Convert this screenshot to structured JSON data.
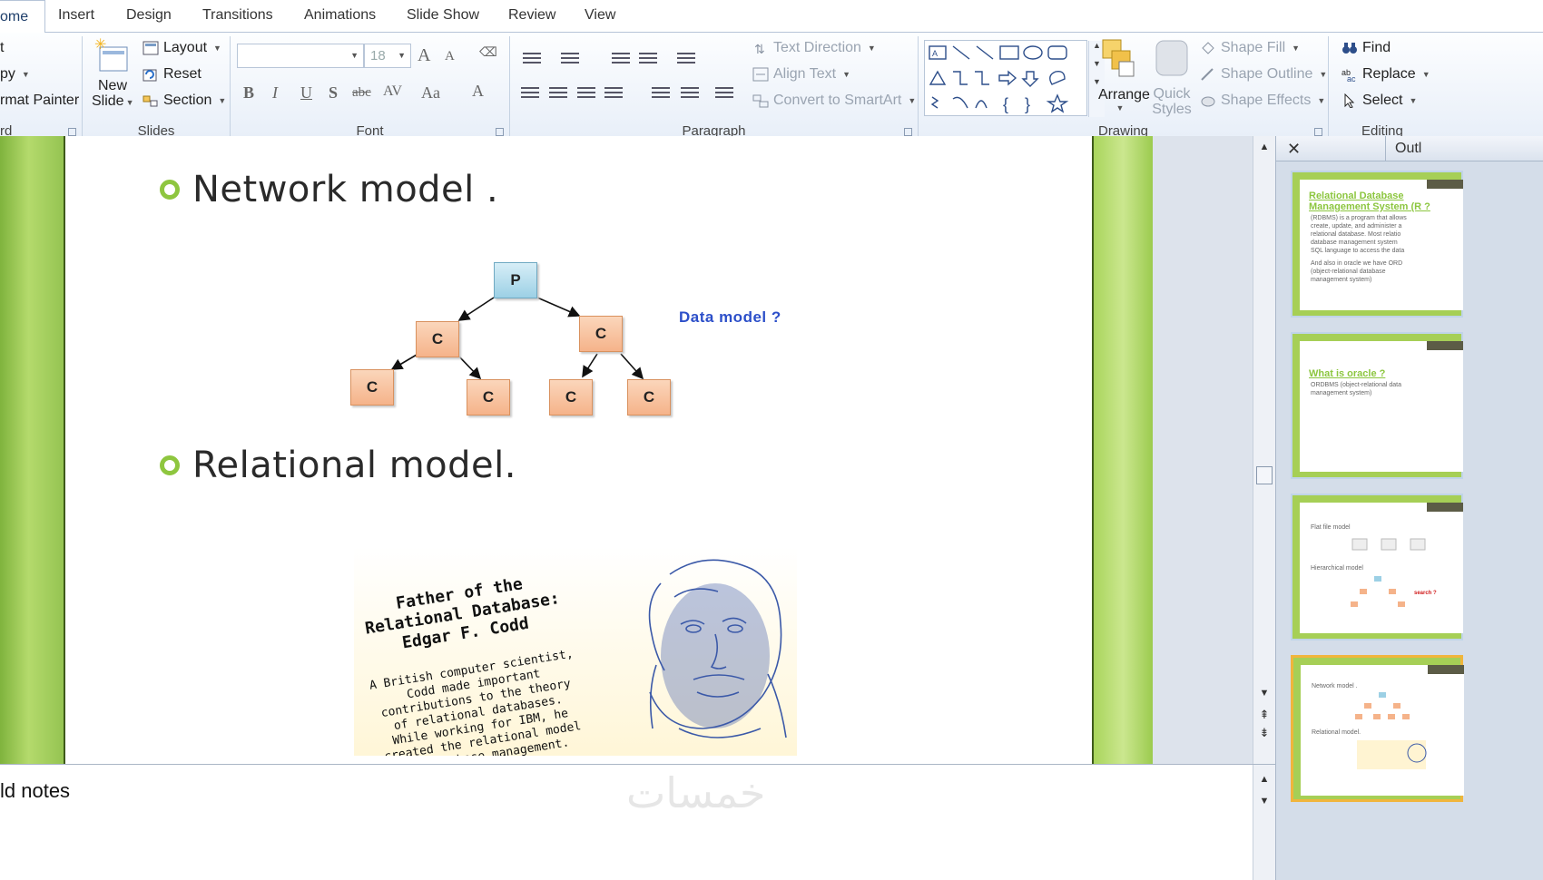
{
  "tabs": [
    "ome",
    "Insert",
    "Design",
    "Transitions",
    "Animations",
    "Slide Show",
    "Review",
    "View"
  ],
  "clipboard": {
    "cut": "t",
    "copy": "py",
    "format_painter": "rmat Painter",
    "label": "rd"
  },
  "slides_group": {
    "new_slide_line1": "New",
    "new_slide_line2": "Slide",
    "layout": "Layout",
    "reset": "Reset",
    "section": "Section",
    "label": "Slides"
  },
  "font_group": {
    "font_name": "",
    "font_size": "18",
    "label": "Font",
    "bold": "B",
    "italic": "I",
    "underline": "U",
    "shadow": "S",
    "strike": "abc",
    "spacing": "AV",
    "case": "Aa",
    "grow": "A",
    "shrink": "A",
    "color": "A"
  },
  "paragraph_group": {
    "text_direction": "Text Direction",
    "align_text": "Align Text",
    "convert_smartart": "Convert to SmartArt",
    "label": "Paragraph"
  },
  "drawing_group": {
    "arrange": "Arrange",
    "quick_styles_1": "Quick",
    "quick_styles_2": "Styles",
    "shape_fill": "Shape Fill",
    "shape_outline": "Shape Outline",
    "shape_effects": "Shape Effects",
    "label": "Drawing"
  },
  "editing_group": {
    "find": "Find",
    "replace": "Replace",
    "select": "Select",
    "label": "Editing"
  },
  "slide": {
    "bullet1": "Network model .",
    "bullet2": "Relational model.",
    "tree": {
      "root": "P",
      "child": "C"
    },
    "data_model_label": "Data model  ?",
    "codd_title": "Father of the Relational Database: Edgar F. Codd",
    "codd_body": "A British computer scientist, Codd made important contributions to the theory of relational databases. While working for IBM, he created the relational model for database management."
  },
  "pane": {
    "tab_label": "Outl"
  },
  "thumbnails": [
    {
      "title": "Relational Database Management System (R ?",
      "lines": [
        "(RDBMS) is a program that allows",
        "create, update, and administer a",
        "relational database. Most relatio",
        "database management system",
        "SQL language to access the data",
        "And also in oracle we have ORD",
        "(object-relational database",
        "management system)"
      ]
    },
    {
      "title": "What is oracle ?",
      "lines": [
        "ORDBMS (object-relational data",
        "management system)"
      ]
    },
    {
      "title": "",
      "lines": [
        "Flat file model",
        "Hierarchical model",
        "search ?"
      ]
    },
    {
      "title": "",
      "lines": [
        "Network model .",
        "Relational model."
      ]
    }
  ],
  "notes": {
    "text": "ld notes",
    "watermark": "خمسات"
  },
  "colors": {
    "accent_green": "#8ec63f",
    "data_model_blue": "#2c4fc9",
    "selected_thumb": "#f0b53c"
  }
}
